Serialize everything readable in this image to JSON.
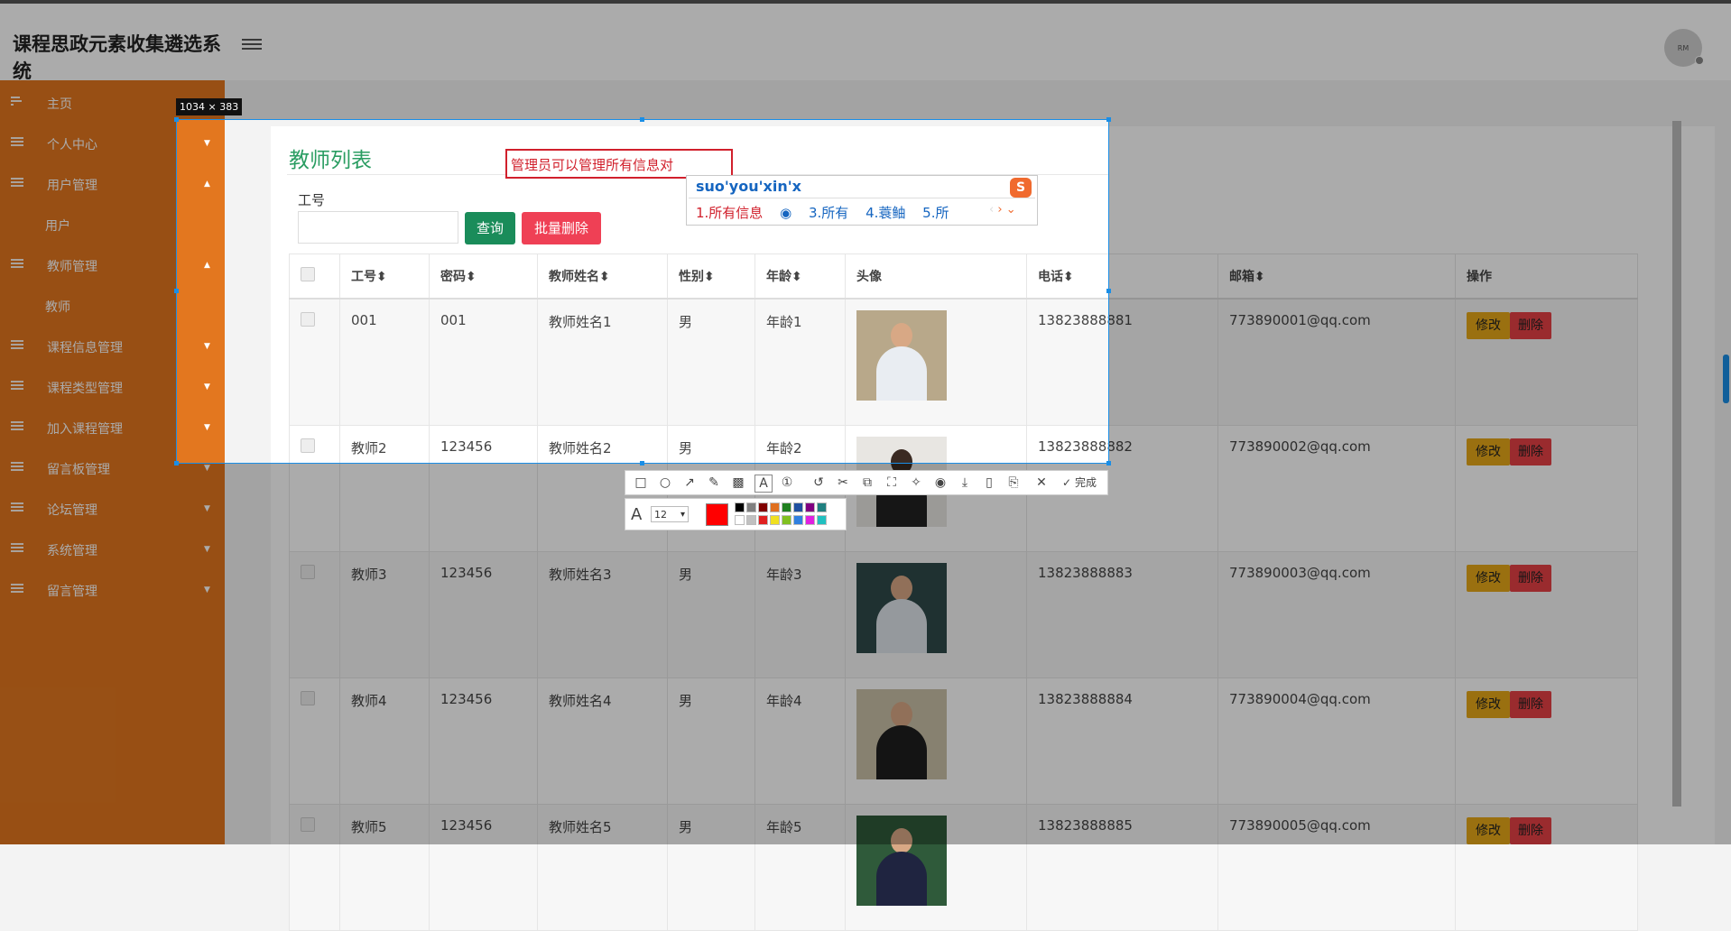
{
  "app": {
    "title": "课程思政元素收集遴选系统",
    "avatar_text": "RM"
  },
  "sidebar": {
    "items": [
      {
        "label": "主页"
      },
      {
        "label": "个人中心"
      },
      {
        "label": "用户管理"
      },
      {
        "label": "用户"
      },
      {
        "label": "教师管理"
      },
      {
        "label": "教师"
      },
      {
        "label": "课程信息管理"
      },
      {
        "label": "课程类型管理"
      },
      {
        "label": "加入课程管理"
      },
      {
        "label": "留言板管理"
      },
      {
        "label": "论坛管理"
      },
      {
        "label": "系统管理"
      },
      {
        "label": "留言管理"
      }
    ]
  },
  "page": {
    "title": "教师列表",
    "search_label": "工号",
    "search_value": "",
    "query_button": "查询",
    "batch_delete_button": "批量删除"
  },
  "table": {
    "headers": [
      "工号",
      "密码",
      "教师姓名",
      "性别",
      "年龄",
      "头像",
      "电话",
      "邮箱",
      "操作"
    ],
    "sortable": [
      true,
      true,
      true,
      true,
      true,
      false,
      true,
      true,
      false
    ],
    "rows": [
      {
        "id": "001",
        "password": "001",
        "name": "教师姓名1",
        "gender": "男",
        "age": "年龄1",
        "phone": "13823888881",
        "email": "773890001@qq.com"
      },
      {
        "id": "教师2",
        "password": "123456",
        "name": "教师姓名2",
        "gender": "男",
        "age": "年龄2",
        "phone": "13823888882",
        "email": "773890002@qq.com"
      },
      {
        "id": "教师3",
        "password": "123456",
        "name": "教师姓名3",
        "gender": "男",
        "age": "年龄3",
        "phone": "13823888883",
        "email": "773890003@qq.com"
      },
      {
        "id": "教师4",
        "password": "123456",
        "name": "教师姓名4",
        "gender": "男",
        "age": "年龄4",
        "phone": "13823888884",
        "email": "773890004@qq.com"
      },
      {
        "id": "教师5",
        "password": "123456",
        "name": "教师姓名5",
        "gender": "男",
        "age": "年龄5",
        "phone": "13823888885",
        "email": "773890005@qq.com"
      }
    ],
    "edit_label": "修改",
    "delete_label": "删除"
  },
  "capture": {
    "size_label": "1034 × 383",
    "annotation_text": "管理员可以管理所有信息对",
    "ime": {
      "pinyin": "suo'you'xin'x",
      "candidates": [
        "1.所有信息",
        "3.所有",
        "4.蓑鲉",
        "5.所"
      ]
    },
    "toolbar_done": "完成",
    "font_size": "12",
    "current_color": "#ff0000",
    "palette": [
      "#000000",
      "#808080",
      "#800000",
      "#e07020",
      "#208020",
      "#2050a0",
      "#800080",
      "#208080",
      "#ffffff",
      "#c0c0c0",
      "#e02020",
      "#f0e020",
      "#80c020",
      "#3080e0",
      "#e020e0",
      "#20c0c0"
    ]
  },
  "colors": {
    "sidebar": "#e3771f",
    "accent_green": "#2a9d62",
    "selection": "#1a8ee6"
  }
}
